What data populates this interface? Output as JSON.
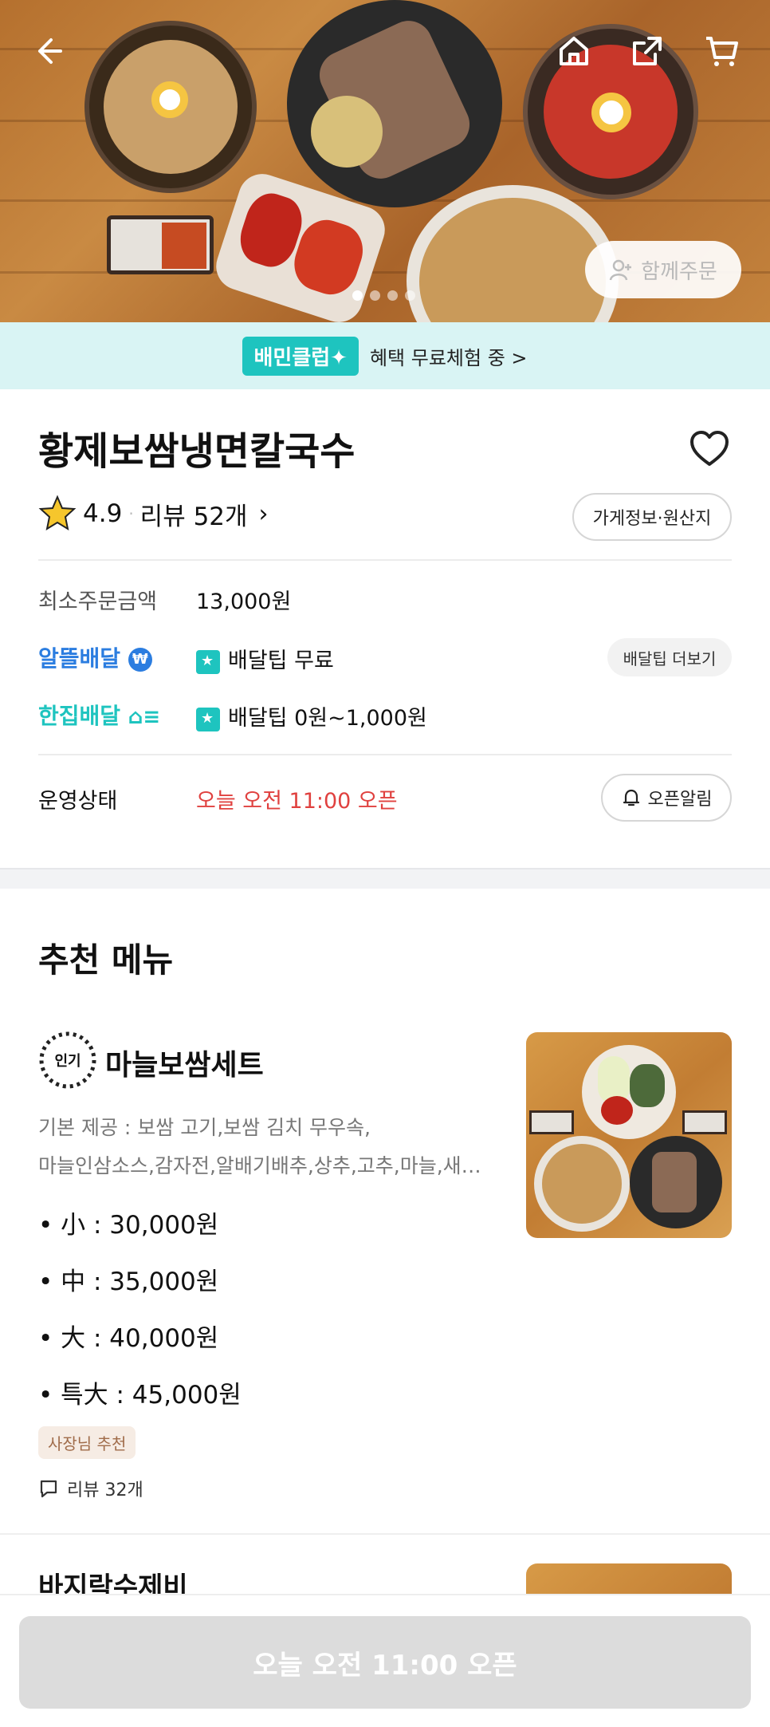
{
  "hero": {
    "together_label": "함께주문",
    "slide_count": 4,
    "active_slide": 1
  },
  "club": {
    "badge": "배민클럽✦",
    "text": "혜택 무료체험 중 >"
  },
  "store": {
    "name": "황제보쌈냉면칼국수",
    "rating": "4.9",
    "reviews_label": "리뷰 52개",
    "info_button": "가게정보·원산지",
    "min_order_label": "최소주문금액",
    "min_order_value": "13,000원",
    "delivery": [
      {
        "brand": "알뜰배달",
        "tip": "배달팁 무료"
      },
      {
        "brand": "한집배달",
        "tip": "배달팁 0원~1,000원"
      }
    ],
    "more_tip_button": "배달팁 더보기",
    "status_label": "운영상태",
    "status_value": "오늘 오전 11:00 오픈",
    "open_alert_button": "오픈알림"
  },
  "section": {
    "title": "추천 메뉴"
  },
  "menu": [
    {
      "badge": "인기",
      "name": "마늘보쌈세트",
      "desc_line1": "기본 제공 : 보쌈 고기,보쌈 김치 무우속,",
      "desc_line2": "마늘인삼소스,감자전,알배기배추,상추,고추,마늘,새…",
      "prices": [
        "• 小 : 30,000원",
        "• 中 : 35,000원",
        "• 大 : 40,000원",
        "• 특大 : 45,000원"
      ],
      "owner_badge": "사장님 추천",
      "reviews": "리뷰 32개"
    },
    {
      "name": "바지락수제비"
    }
  ],
  "bottom": {
    "order_button": "오늘 오전 11:00 오픈"
  },
  "colors": {
    "accent_mint": "#1ec4bf",
    "brand_blue": "#2b7de0",
    "status_red": "#e0413f",
    "club_bg": "#d9f4f4"
  }
}
